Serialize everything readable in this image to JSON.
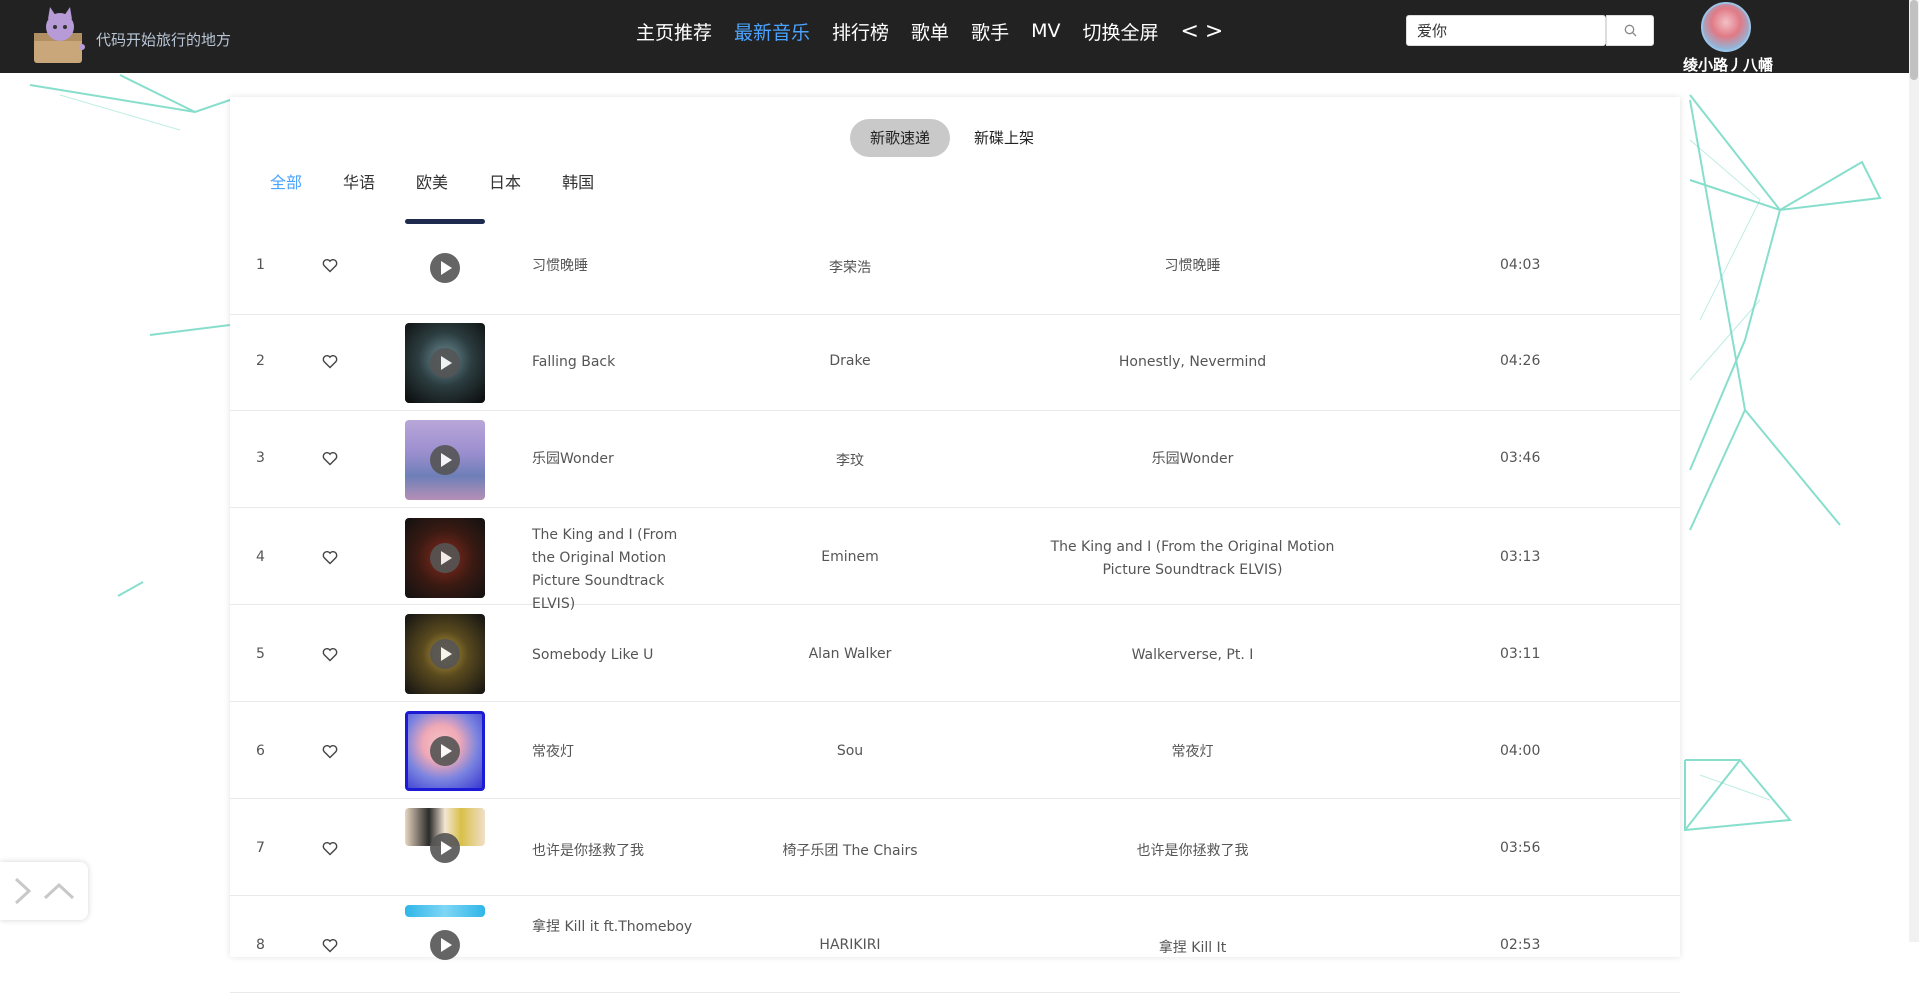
{
  "app": {
    "logo_text": "代码开始旅行的地方"
  },
  "nav": {
    "items": [
      "主页推荐",
      "最新音乐",
      "排行榜",
      "歌单",
      "歌手",
      "MV",
      "切换全屏"
    ],
    "active_index": 1,
    "back_arrow": "<",
    "forward_arrow": ">"
  },
  "search": {
    "value": "爱你",
    "icon": "search-icon"
  },
  "user": {
    "name": "绫小路丿八幡"
  },
  "sub_tabs": {
    "items": [
      "新歌速递",
      "新碟上架"
    ],
    "active_index": 0
  },
  "regions": {
    "items": [
      "全部",
      "华语",
      "欧美",
      "日本",
      "韩国"
    ],
    "active_index": 0
  },
  "colors": {
    "topbar": "#222222",
    "accent": "#4aa3ff",
    "bg_lines": "#5fd3bc"
  },
  "songs": [
    {
      "index": "1",
      "name": "习惯晚睡",
      "artist": "李荣浩",
      "album": "习惯晚睡",
      "duration": "04:03"
    },
    {
      "index": "2",
      "name": "Falling Back",
      "artist": "Drake",
      "album": "Honestly, Nevermind",
      "duration": "04:26"
    },
    {
      "index": "3",
      "name": "乐园Wonder",
      "artist": "李玟",
      "album": "乐园Wonder",
      "duration": "03:46"
    },
    {
      "index": "4",
      "name": "The King and I (From the Original Motion Picture Soundtrack ELVIS)",
      "artist": "Eminem",
      "album": "The King and I (From the Original Motion Picture Soundtrack ELVIS)",
      "duration": "03:13"
    },
    {
      "index": "5",
      "name": "Somebody Like U",
      "artist": "Alan Walker",
      "album": "Walkerverse, Pt. I",
      "duration": "03:11"
    },
    {
      "index": "6",
      "name": "常夜灯",
      "artist": "Sou",
      "album": "常夜灯",
      "duration": "04:00"
    },
    {
      "index": "7",
      "name": "也许是你拯救了我",
      "artist": "椅子乐团 The Chairs",
      "album": "也许是你拯救了我",
      "duration": "03:56"
    },
    {
      "index": "8",
      "name": "拿捏 Kill it ft.Thomeboy",
      "artist": "HARIKIRI",
      "album": "拿捏 Kill It",
      "duration": "02:53"
    }
  ],
  "float_controls": {
    "next": ">",
    "up": "^"
  }
}
